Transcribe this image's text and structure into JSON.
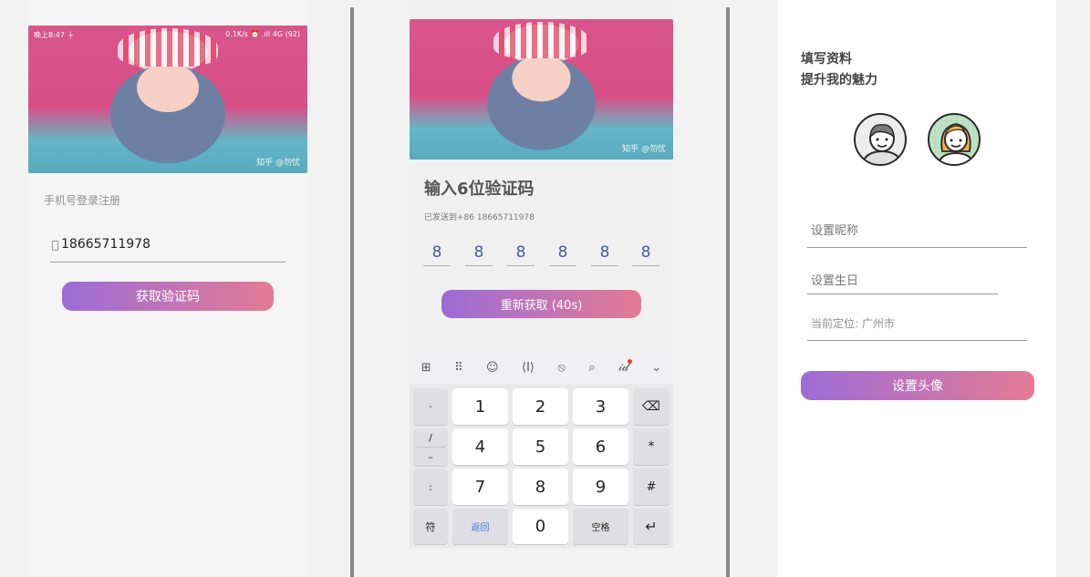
{
  "screen1": {
    "status_left": "晚上8:47 ⏚",
    "status_right": "0.1K/s ⏰ .ıll 4G (92)",
    "watermark": "知乎 @勿忧",
    "section_label": "手机号登录注册",
    "phone_icon": "phone-icon",
    "phone_value": "18665711978",
    "get_code_button": "获取验证码"
  },
  "screen2": {
    "watermark": "知乎 @勿忧",
    "title": "输入6位验证码",
    "sent_to": "已发送到+86 18665711978",
    "code_digits": [
      "8",
      "8",
      "8",
      "8",
      "8",
      "8"
    ],
    "resend_button": "重新获取 (40s)",
    "keyboard": {
      "toolbar": [
        "⊞",
        "⠿",
        "☺",
        "⟨I⟩",
        "⦸",
        "⌕",
        "𝒾𝒹",
        "⌄"
      ],
      "side_keys": [
        "·",
        "/",
        "–",
        ":"
      ],
      "rows": [
        [
          "1",
          "2",
          "3"
        ],
        [
          "4",
          "5",
          "6"
        ],
        [
          "7",
          "8",
          "9"
        ]
      ],
      "right_keys": [
        "⌫",
        "*",
        "#"
      ],
      "bottom": {
        "symbol": "符",
        "back": "返回",
        "zero": "0",
        "space": "空格",
        "enter": "↵"
      }
    }
  },
  "screen3": {
    "heading_line1": "填写资料",
    "heading_line2": "提升我的魅力",
    "male_avatar_icon": "male-avatar-icon",
    "female_avatar_icon": "female-avatar-icon",
    "nickname_placeholder": "设置昵称",
    "birthday_placeholder": "设置生日",
    "location_text": "当前定位: 广州市",
    "set_avatar_button": "设置头像"
  },
  "colors": {
    "gradient_start": "#9c6cd7",
    "gradient_end": "#e47b95",
    "digit": "#4a5c97"
  }
}
